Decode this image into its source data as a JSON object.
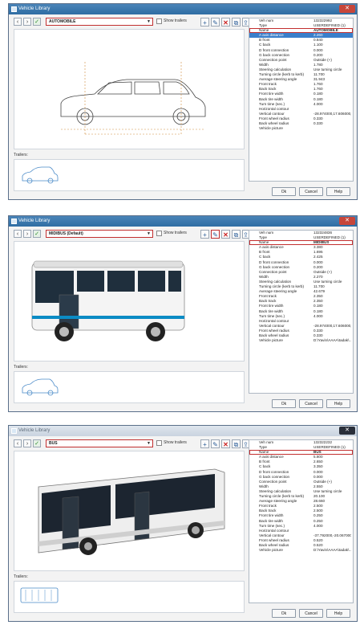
{
  "windows": [
    {
      "title": "Vehicle Library",
      "dropdown": "AUTOMOBILE",
      "show_trailers": "Show trailers",
      "trailers_label": "Trailers:",
      "buttons": {
        "ok": "Ok",
        "cancel": "Cancel",
        "help": "Help"
      },
      "properties": [
        {
          "k": "Veh num",
          "v": "132322992"
        },
        {
          "k": "Type",
          "v": "USERDEFINED (1)"
        },
        {
          "k": "Name",
          "v": "AUTOMOBILE"
        },
        {
          "k": "A axis distance",
          "v": "2.260"
        },
        {
          "k": "B front",
          "v": "0.840"
        },
        {
          "k": "C back",
          "v": "1.100"
        },
        {
          "k": "D front connection",
          "v": "0.000"
        },
        {
          "k": "G back connection",
          "v": "0.200"
        },
        {
          "k": "Connection point",
          "v": "Outside (+)"
        },
        {
          "k": "Width",
          "v": "1.780"
        },
        {
          "k": "Steering calculation",
          "v": "Use turning circle"
        },
        {
          "k": "Turning circle (kerb to kerb)",
          "v": "11.700"
        },
        {
          "k": "Average steering angle",
          "v": "31.943"
        },
        {
          "k": "Front track",
          "v": "1.760"
        },
        {
          "k": "Back track",
          "v": "1.760"
        },
        {
          "k": "Front tire width",
          "v": "0.180"
        },
        {
          "k": "Back tire width",
          "v": "0.180"
        },
        {
          "k": "Turn time (sec.)",
          "v": "4.000"
        },
        {
          "k": "Horizontal contour",
          "v": ""
        },
        {
          "k": "Vertical contour",
          "v": "-28.974000,17.606000,..."
        },
        {
          "k": "Front wheel radius",
          "v": "0.330"
        },
        {
          "k": "Back wheel radius",
          "v": "0.330"
        },
        {
          "k": "Vehicle picture",
          "v": ""
        }
      ]
    },
    {
      "title": "Vehicle Library",
      "dropdown": "MIDIBUS (Default)",
      "show_trailers": "Show trailers",
      "trailers_label": "Trailers:",
      "buttons": {
        "ok": "Ok",
        "cancel": "Cancel",
        "help": "Help"
      },
      "properties": [
        {
          "k": "Veh num",
          "v": "132324836"
        },
        {
          "k": "Type",
          "v": "USERDEFINED (1)"
        },
        {
          "k": "Name",
          "v": "MIDIBUS"
        },
        {
          "k": "A axis distance",
          "v": "3.380"
        },
        {
          "k": "B front",
          "v": "1.695"
        },
        {
          "k": "C back",
          "v": "2.425"
        },
        {
          "k": "D front connection",
          "v": "0.000"
        },
        {
          "k": "G back connection",
          "v": "0.200"
        },
        {
          "k": "Connection point",
          "v": "Outside (+)"
        },
        {
          "k": "Width",
          "v": "2.270"
        },
        {
          "k": "Steering calculation",
          "v": "Use turning circle"
        },
        {
          "k": "Turning circle (kerb to kerb)",
          "v": "11.700"
        },
        {
          "k": "Average steering angle",
          "v": "42.679"
        },
        {
          "k": "Front track",
          "v": "2.350"
        },
        {
          "k": "Back track",
          "v": "2.350"
        },
        {
          "k": "Front tire width",
          "v": "0.180"
        },
        {
          "k": "Back tire width",
          "v": "0.180"
        },
        {
          "k": "Turn time (sec.)",
          "v": "4.000"
        },
        {
          "k": "Horizontal contour",
          "v": ""
        },
        {
          "k": "Vertical contour",
          "v": "-28.974000,17.606000,..."
        },
        {
          "k": "Front wheel radius",
          "v": "0.330"
        },
        {
          "k": "Back wheel radius",
          "v": "0.330"
        },
        {
          "k": "Vehicle picture",
          "v": "D:\\Yavin\\AAAA\\tadak\\..."
        }
      ]
    },
    {
      "title": "Vehicle Library",
      "dropdown": "BUS",
      "show_trailers": "Show trailers",
      "trailers_label": "Trailers:",
      "buttons": {
        "ok": "Ok",
        "cancel": "Cancel",
        "help": "Help"
      },
      "properties": [
        {
          "k": "Veh num",
          "v": "132322232"
        },
        {
          "k": "Type",
          "v": "USERDEFINED (1)"
        },
        {
          "k": "Name",
          "v": "BUS"
        },
        {
          "k": "A axis distance",
          "v": "5.800"
        },
        {
          "k": "B front",
          "v": "2.650"
        },
        {
          "k": "C back",
          "v": "3.350"
        },
        {
          "k": "D front connection",
          "v": "0.000"
        },
        {
          "k": "G back connection",
          "v": "0.000"
        },
        {
          "k": "Connection point",
          "v": "Outside (+)"
        },
        {
          "k": "Width",
          "v": "2.550"
        },
        {
          "k": "Steering calculation",
          "v": "Use turning circle"
        },
        {
          "k": "Turning circle (kerb to kerb)",
          "v": "20.100"
        },
        {
          "k": "Average steering angle",
          "v": "28.660"
        },
        {
          "k": "Front track",
          "v": "2.500"
        },
        {
          "k": "Back track",
          "v": "2.500"
        },
        {
          "k": "Front tire width",
          "v": "0.250"
        },
        {
          "k": "Back tire width",
          "v": "0.250"
        },
        {
          "k": "Turn time (sec.)",
          "v": "4.000"
        },
        {
          "k": "Horizontal contour",
          "v": ""
        },
        {
          "k": "Vertical contour",
          "v": "-37.792000,-20.067000..."
        },
        {
          "k": "Front wheel radius",
          "v": "0.520"
        },
        {
          "k": "Back wheel radius",
          "v": "0.520"
        },
        {
          "k": "Vehicle picture",
          "v": "D:\\Yavin\\AAAA\\tadak\\..."
        }
      ]
    }
  ]
}
